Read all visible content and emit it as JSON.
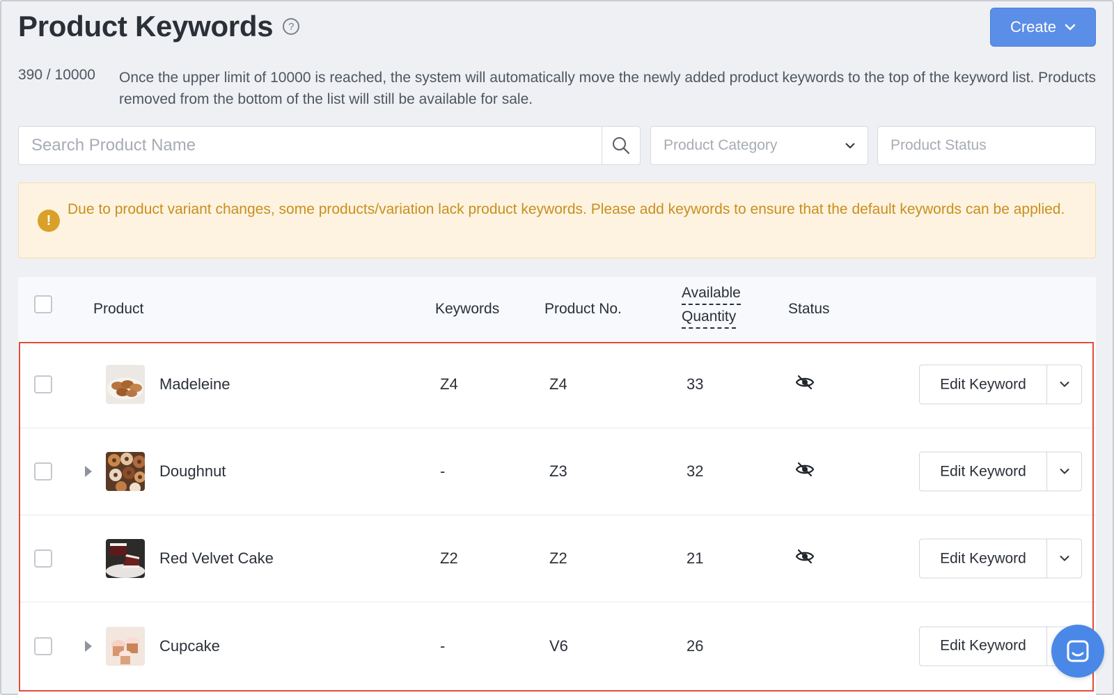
{
  "header": {
    "title": "Product Keywords",
    "help_glyph": "?",
    "create_label": "Create"
  },
  "info": {
    "count": "390 / 10000",
    "message": "Once the upper limit of 10000 is reached, the system will automatically move the newly added product keywords to the top of the keyword list. Products removed from the bottom of the list will still be available for sale."
  },
  "filters": {
    "search_placeholder": "Search Product Name",
    "category_placeholder": "Product Category",
    "status_placeholder": "Product Status"
  },
  "alert": {
    "glyph": "!",
    "message": "Due to product variant changes, some products/variation lack product keywords. Please add keywords to ensure that the default keywords can be applied."
  },
  "table": {
    "headers": {
      "product": "Product",
      "keywords": "Keywords",
      "product_no": "Product No.",
      "available_1": "Available",
      "available_2": "Quantity",
      "status": "Status"
    },
    "edit_label": "Edit Keyword",
    "rows": [
      {
        "name": "Madeleine",
        "keywords": "Z4",
        "product_no": "Z4",
        "quantity": "33",
        "has_variants": false,
        "status_icon": "eye-hidden-icon"
      },
      {
        "name": "Doughnut",
        "keywords": "-",
        "product_no": "Z3",
        "quantity": "32",
        "has_variants": true,
        "status_icon": "eye-hidden-icon"
      },
      {
        "name": "Red Velvet Cake",
        "keywords": "Z2",
        "product_no": "Z2",
        "quantity": "21",
        "has_variants": false,
        "status_icon": "eye-hidden-icon"
      },
      {
        "name": "Cupcake",
        "keywords": "-",
        "product_no": "V6",
        "quantity": "26",
        "has_variants": true,
        "status_icon": ""
      }
    ]
  },
  "colors": {
    "primary": "#5b8ee6",
    "warning_bg": "#fdf3e0",
    "warning_text": "#c88f1e",
    "highlight_border": "#e24a3b"
  }
}
